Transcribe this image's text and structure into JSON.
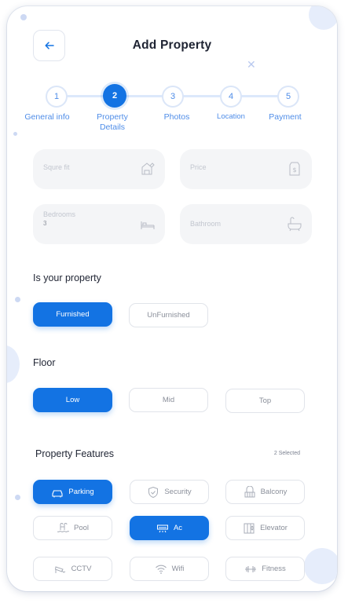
{
  "header": {
    "title": "Add Property"
  },
  "stepper": {
    "steps": [
      {
        "number": "1",
        "label": "General info"
      },
      {
        "number": "2",
        "label": "Property Details"
      },
      {
        "number": "3",
        "label": "Photos"
      },
      {
        "number": "4",
        "label": "Location"
      },
      {
        "number": "5",
        "label": "Payment"
      }
    ],
    "active_step": 2
  },
  "form": {
    "square_feet": {
      "placeholder": "Squre fit",
      "icon": "ruler-house-icon"
    },
    "price": {
      "placeholder": "Price",
      "icon": "price-tag-icon"
    },
    "bedrooms": {
      "placeholder": "Bedrooms",
      "value": "3",
      "icon": "bed-icon"
    },
    "bathroom": {
      "placeholder": "Bathroom",
      "icon": "bathtub-icon"
    }
  },
  "furnishing": {
    "title": "Is your property",
    "options": [
      "Furnished",
      "UnFurnished"
    ],
    "selected": "Furnished"
  },
  "floor": {
    "title": "Floor",
    "options": [
      "Low",
      "Mid",
      "Top"
    ],
    "selected": "Low"
  },
  "features": {
    "title": "Property Features",
    "selected_count": "2 Selected",
    "items": [
      {
        "label": "Parking",
        "icon": "car-icon",
        "selected": true
      },
      {
        "label": "Security",
        "icon": "shield-icon",
        "selected": false
      },
      {
        "label": "Balcony",
        "icon": "balcony-icon",
        "selected": false
      },
      {
        "label": "Pool",
        "icon": "pool-icon",
        "selected": false
      },
      {
        "label": "Ac",
        "icon": "air-conditioner-icon",
        "selected": true
      },
      {
        "label": "Elevator",
        "icon": "elevator-icon",
        "selected": false
      },
      {
        "label": "CCTV",
        "icon": "cctv-icon",
        "selected": false
      },
      {
        "label": "Wifi",
        "icon": "wifi-icon",
        "selected": false
      },
      {
        "label": "Fitness",
        "icon": "dumbbell-icon",
        "selected": false
      }
    ]
  },
  "colors": {
    "accent": "#1373e3",
    "field_bg": "#f4f5f7",
    "step_text": "#4f8de8"
  }
}
